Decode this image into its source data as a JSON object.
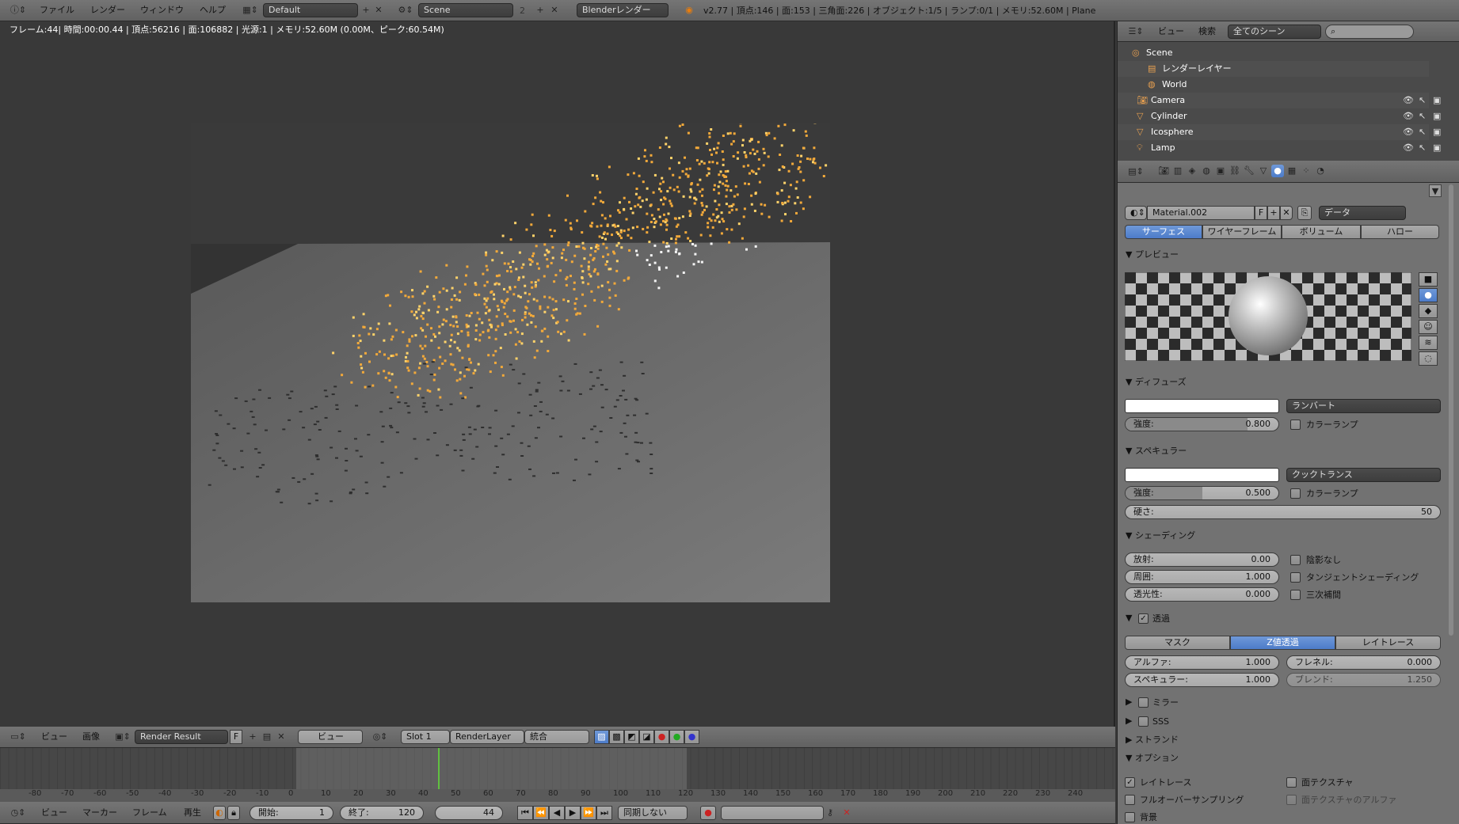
{
  "topbar": {
    "menus": [
      "ファイル",
      "レンダー",
      "ウィンドウ",
      "ヘルプ"
    ],
    "layout": "Default",
    "scene": "Scene",
    "scene_users": "2",
    "engine": "Blenderレンダー",
    "stats": "v2.77 | 頂点:146 | 面:153 | 三角面:226 | オブジェクト:1/5 | ランプ:0/1 | メモリ:52.60M | Plane"
  },
  "render_info": "フレーム:44| 時間:00:00.44 | 頂点:56216 | 面:106882 | 光源:1 | メモリ:52.60M (0.00M、ピーク:60.54M)",
  "image_header": {
    "menus": [
      "ビュー",
      "画像"
    ],
    "image_name": "Render Result",
    "fake_user": "F",
    "view": "ビュー",
    "slot": "Slot 1",
    "layer": "RenderLayer",
    "pass": "統合"
  },
  "timeline": {
    "ticks": [
      "-80",
      "-70",
      "-60",
      "-50",
      "-40",
      "-30",
      "-20",
      "-10",
      "0",
      "10",
      "20",
      "30",
      "40",
      "50",
      "60",
      "70",
      "80",
      "90",
      "100",
      "110",
      "120",
      "130",
      "140",
      "150",
      "160",
      "170",
      "180",
      "190",
      "200",
      "210",
      "220",
      "230",
      "240"
    ],
    "current_frame": 44,
    "menus": [
      "ビュー",
      "マーカー",
      "フレーム",
      "再生"
    ],
    "start_label": "開始:",
    "start_value": "1",
    "end_label": "終了:",
    "end_value": "120",
    "frame_value": "44",
    "sync": "同期しない"
  },
  "outliner": {
    "menus": [
      "ビュー",
      "検索"
    ],
    "filter": "全てのシーン",
    "rows": [
      "Scene",
      "レンダーレイヤー",
      "World",
      "Camera",
      "Cylinder",
      "Icosphere",
      "Lamp"
    ]
  },
  "properties": {
    "material_name": "Material.002",
    "fake_user": "F",
    "link": "データ",
    "tabs": [
      "サーフェス",
      "ワイヤーフレーム",
      "ボリューム",
      "ハロー"
    ],
    "preview": {
      "title": "プレビュー"
    },
    "diffuse": {
      "title": "ディフューズ",
      "shader": "ランバート",
      "intensity_label": "強度:",
      "intensity": 0.8,
      "intensity_text": "0.800",
      "ramp": "カラーランプ"
    },
    "specular": {
      "title": "スペキュラー",
      "shader": "クックトランス",
      "intensity_label": "強度:",
      "intensity": 0.5,
      "intensity_text": "0.500",
      "ramp": "カラーランプ",
      "hardness_label": "硬さ:",
      "hardness": "50"
    },
    "shading": {
      "title": "シェーディング",
      "emit_label": "放射:",
      "emit": "0.00",
      "ambient_label": "周囲:",
      "ambient": "1.000",
      "translucency_label": "透光性:",
      "translucency": "0.000",
      "shadeless": "陰影なし",
      "tangent": "タンジェントシェーディング",
      "cubic": "三次補間"
    },
    "transparency": {
      "title": "透過",
      "modes": [
        "マスク",
        "Z値透過",
        "レイトレース"
      ],
      "alpha_label": "アルファ:",
      "alpha": "1.000",
      "fresnel_label": "フレネル:",
      "fresnel": "0.000",
      "specular_label": "スペキュラー:",
      "specular": "1.000",
      "blend_label": "ブレンド:",
      "blend": "1.250"
    },
    "mirror": "ミラー",
    "sss": "SSS",
    "strand": "ストランド",
    "options": {
      "title": "オプション",
      "raytrace": "レイトレース",
      "face_texture": "面テクスチャ",
      "full_oversampling": "フルオーバーサンプリング",
      "face_texture_alpha": "面テクスチャのアルファ",
      "background": "背景"
    }
  }
}
